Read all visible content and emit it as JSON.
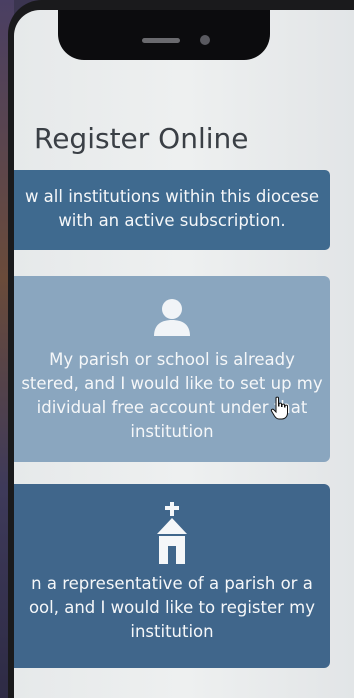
{
  "page": {
    "title": "Register Online"
  },
  "banner": {
    "line1": "w all institutions within this diocese",
    "line2": "with an active subscription."
  },
  "options": [
    {
      "icon": "user-silhouette-icon",
      "lines": [
        "My parish or school is already",
        "stered, and I would like to set up my",
        "idividual free account under that",
        "institution"
      ]
    },
    {
      "icon": "church-icon",
      "lines": [
        "n a representative of a parish or a",
        "ool, and I would like to register my",
        "institution"
      ]
    }
  ],
  "colors": {
    "banner": "#3f6a8f",
    "option_existing": "#8aa6bf",
    "option_register": "#40668b",
    "title": "#3a3f45"
  }
}
